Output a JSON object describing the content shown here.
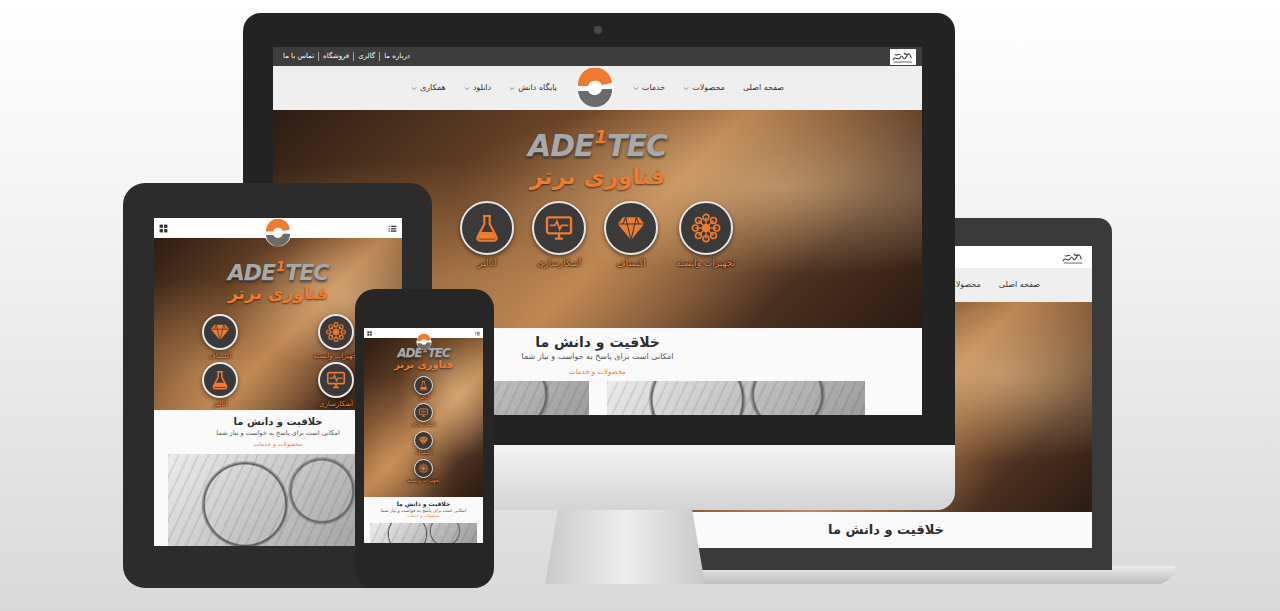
{
  "devices": [
    {
      "kind": "laptop",
      "nav": [
        {
          "label": "صفحه اصلی",
          "dropdown": false
        },
        {
          "label": "محصولات",
          "dropdown": false
        }
      ],
      "heading": "خلاقیت و دانش ما"
    },
    {
      "kind": "desktop",
      "topbar_links": [
        "درباره ما",
        "گالری",
        "فروشگاه",
        "تماس با ما"
      ],
      "nav": [
        {
          "label": "صفحه اصلی",
          "dropdown": false
        },
        {
          "label": "محصولات",
          "dropdown": true
        },
        {
          "label": "خدمات",
          "dropdown": true
        },
        {
          "label": "پایگاه دانش",
          "dropdown": true
        },
        {
          "label": "دانلود",
          "dropdown": true
        },
        {
          "label": "همکاری",
          "dropdown": true
        }
      ],
      "brand": {
        "start": "ADE",
        "mark": "1",
        "end": "TEC"
      },
      "tagline": "فناوری برتر",
      "features": [
        {
          "label": "تجهیزات وابسته"
        },
        {
          "label": "اکتشاف"
        },
        {
          "label": "آشکارسازی"
        },
        {
          "label": "آنالیز"
        }
      ],
      "heading": "خلاقیت و دانش ما",
      "subheading": "امکانی است برای پاسخ به خواست و نیاز شما",
      "link": "محصولات و خدمات"
    },
    {
      "kind": "tablet",
      "brand": {
        "start": "ADE",
        "mark": "1",
        "end": "TEC"
      },
      "tagline": "فناوری برتر",
      "features": [
        {
          "label": "تجهیزات وابسته"
        },
        {
          "label": "اکتشاف"
        },
        {
          "label": "آشکارسازی"
        },
        {
          "label": "آنالیز"
        }
      ],
      "heading": "خلاقیت و دانش ما",
      "subheading": "امکانی است برای پاسخ به خواست و نیاز شما",
      "link": "محصولات و خدمات"
    },
    {
      "kind": "phone",
      "brand": {
        "start": "ADE",
        "mark": "1",
        "end": "TEC"
      },
      "tagline": "فناوری برتر",
      "features": [
        {
          "label": "تجهیزات وابسته"
        },
        {
          "label": "اکتشاف"
        },
        {
          "label": "آشکارسازی"
        },
        {
          "label": "آنالیز"
        }
      ],
      "heading": "خلاقیت و دانش ما",
      "subheading": "امکانی است برای پاسخ به خواست و نیاز شما",
      "link": "محصولات و خدمات"
    }
  ]
}
